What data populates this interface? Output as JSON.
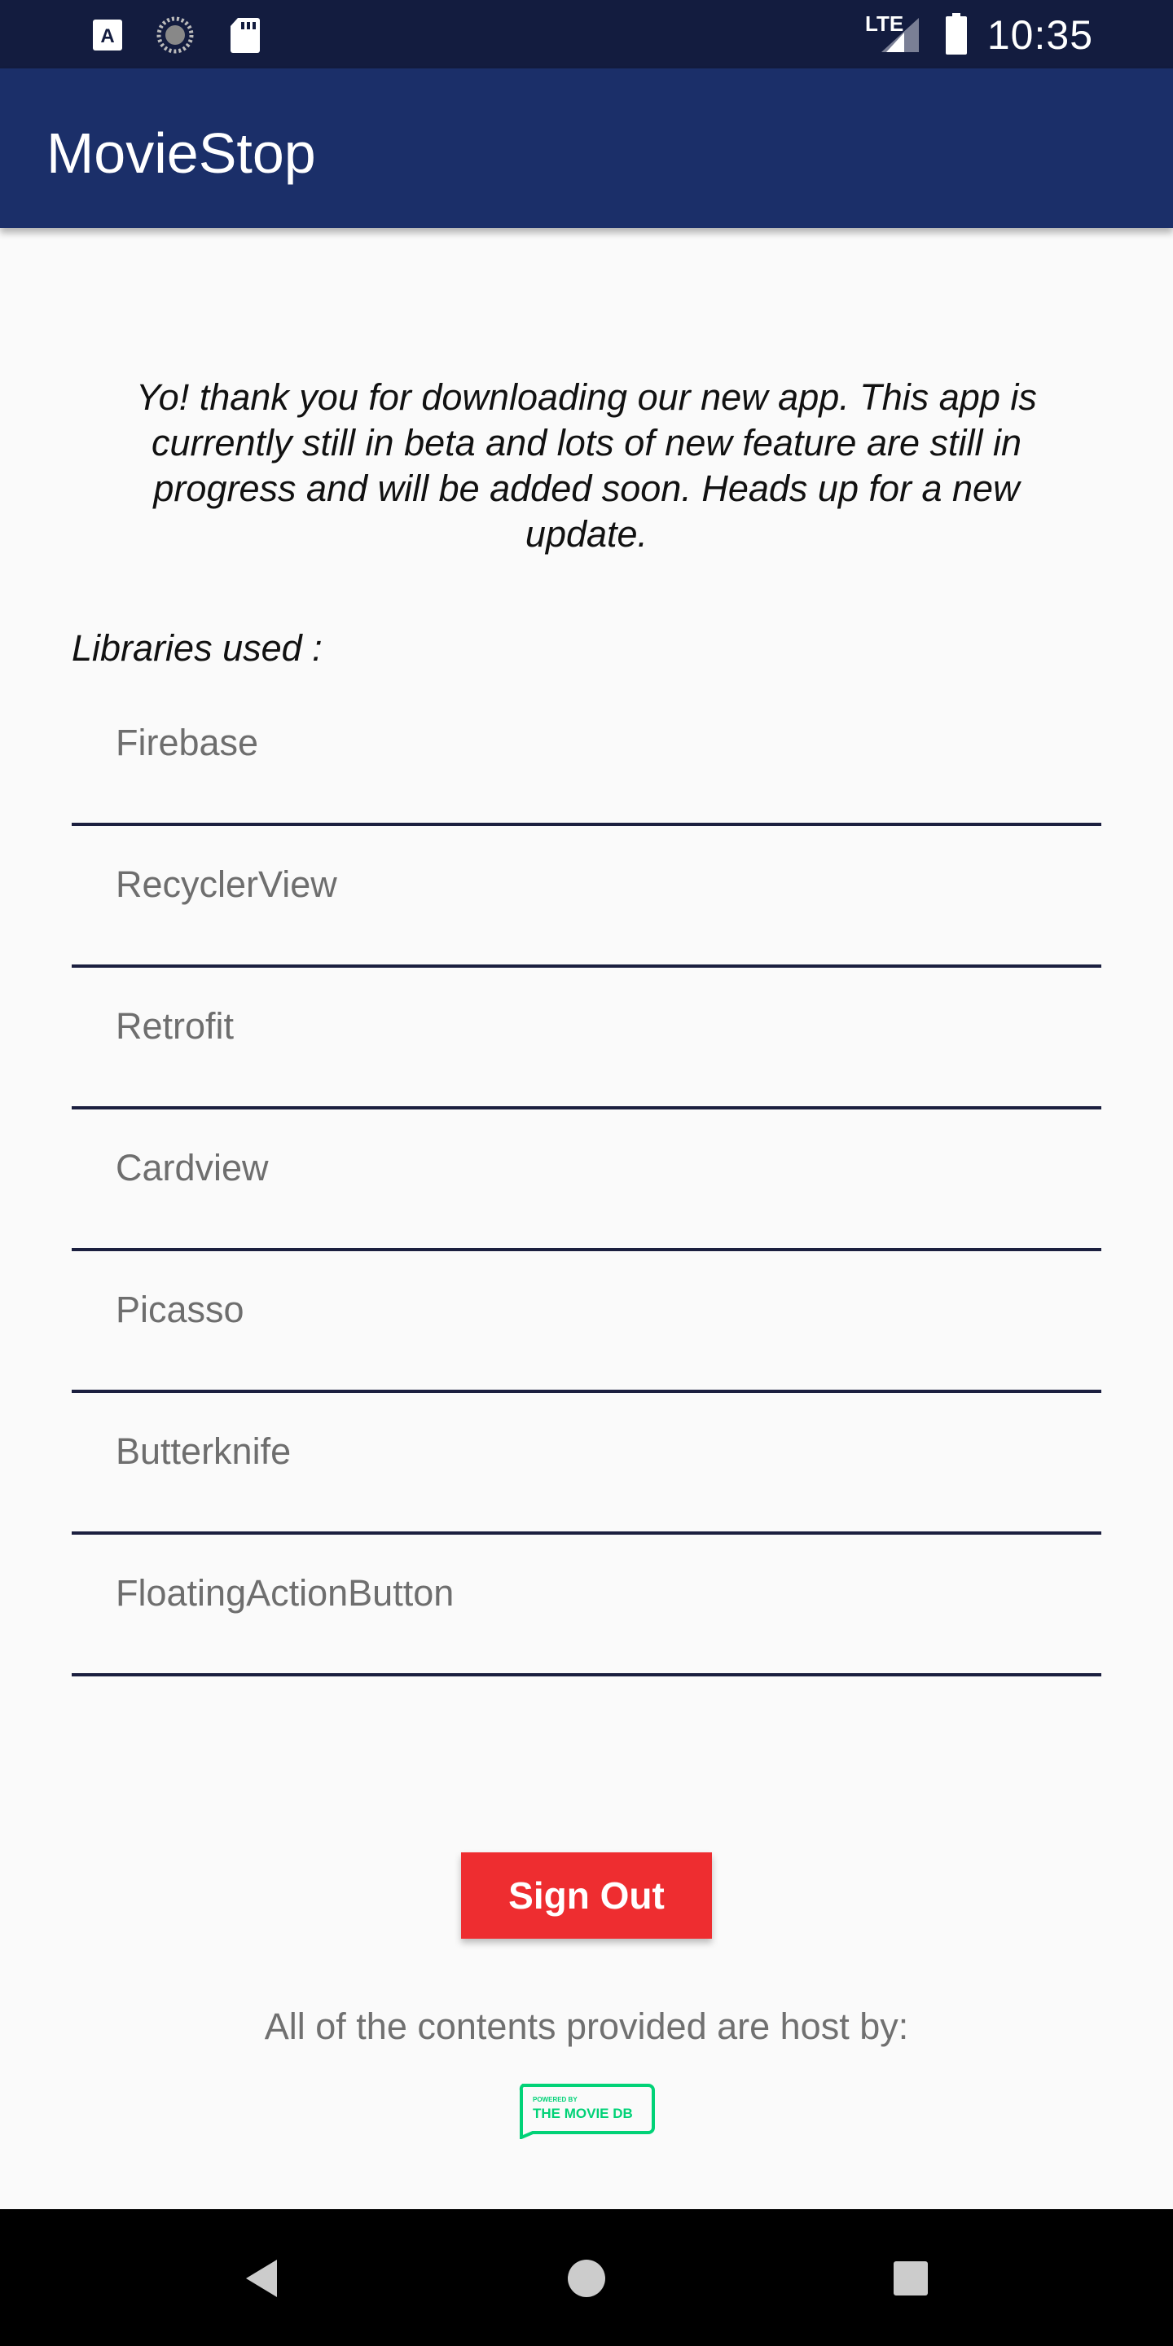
{
  "status_bar": {
    "time": "10:35",
    "network": "LTE",
    "icons": [
      "keyboard-a-icon",
      "loading-circle-icon",
      "sd-card-icon",
      "lte-signal-icon",
      "battery-icon"
    ]
  },
  "app_bar": {
    "title": "MovieStop"
  },
  "intro_text": "Yo! thank you for downloading our new app. This app is currently still in beta and lots of new feature are still in progress and will be added soon. Heads up for a new update.",
  "libraries": {
    "label": "Libraries used :",
    "items": [
      "Firebase",
      "RecyclerView",
      "Retrofit",
      "Cardview",
      "Picasso",
      "Butterknife",
      "FloatingActionButton"
    ]
  },
  "sign_out_label": "Sign Out",
  "credits_text": "All of the contents provided are host by:",
  "logo": {
    "small_text": "POWERED BY",
    "name": "THE MOVIE DB",
    "color": "#01d277"
  },
  "colors": {
    "status_bar": "#131c3f",
    "app_bar": "#1b2f69",
    "accent": "#ee2d30",
    "divider": "#1b1f3f"
  },
  "nav": [
    "back-icon",
    "home-icon",
    "recents-icon"
  ]
}
